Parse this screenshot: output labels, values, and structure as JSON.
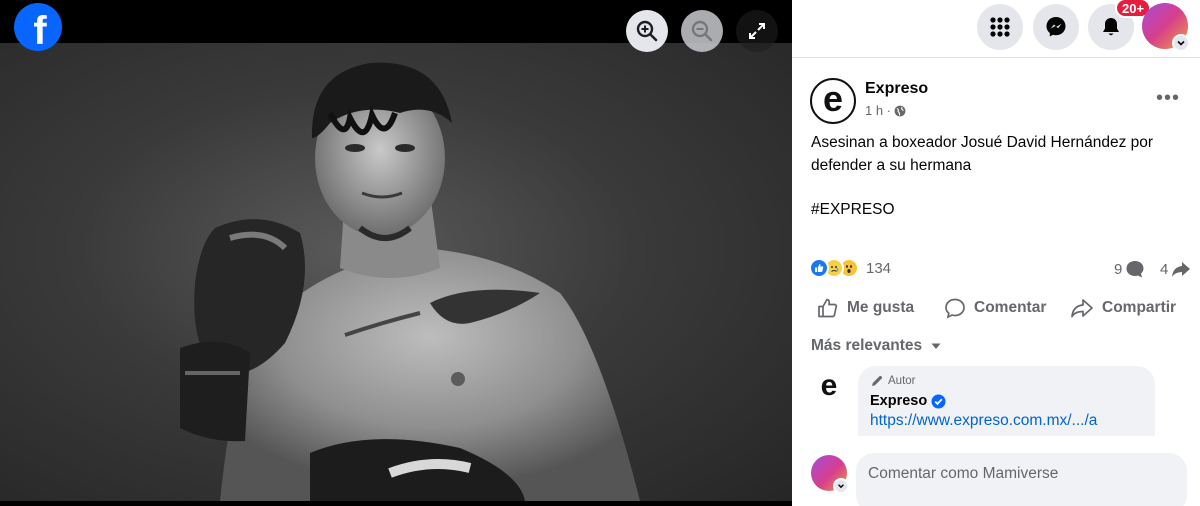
{
  "viewer": {
    "logo_icon": "facebook-logo-icon",
    "logo_letter": "f",
    "buttons": {
      "zoom_in": "zoom-in-icon",
      "zoom_out": "zoom-out-icon",
      "fullscreen": "fullscreen-icon"
    }
  },
  "topbar": {
    "menu_icon": "grid-menu-icon",
    "messenger_icon": "messenger-icon",
    "notifications_icon": "bell-icon",
    "notifications_badge": "20+",
    "account_icon": "chevron-down-icon"
  },
  "post": {
    "author": "Expreso",
    "avatar_letter": "e",
    "time": "1 h ·",
    "audience_icon": "globe-icon",
    "more_label": "•••",
    "text": "Asesinan a boxeador Josué David Hernández por defender a su hermana",
    "hashtag": "#EXPRESO",
    "reactions": {
      "types": [
        "like",
        "sad",
        "wow"
      ],
      "count": "134"
    },
    "comments_count": "9",
    "shares_count": "4",
    "actions": {
      "like": "Me gusta",
      "comment": "Comentar",
      "share": "Compartir"
    },
    "sort_label": "Más relevantes"
  },
  "comment": {
    "author_tag": "Autor",
    "author": "Expreso",
    "verified_icon": "verified-badge-icon",
    "link": "https://www.expreso.com.mx/.../a"
  },
  "composer": {
    "placeholder": "Comentar como Mamiverse"
  },
  "colors": {
    "facebook_blue": "#0866ff",
    "link": "#0064d1",
    "badge_red": "#e41e3f",
    "secondary_text": "#65676b"
  }
}
